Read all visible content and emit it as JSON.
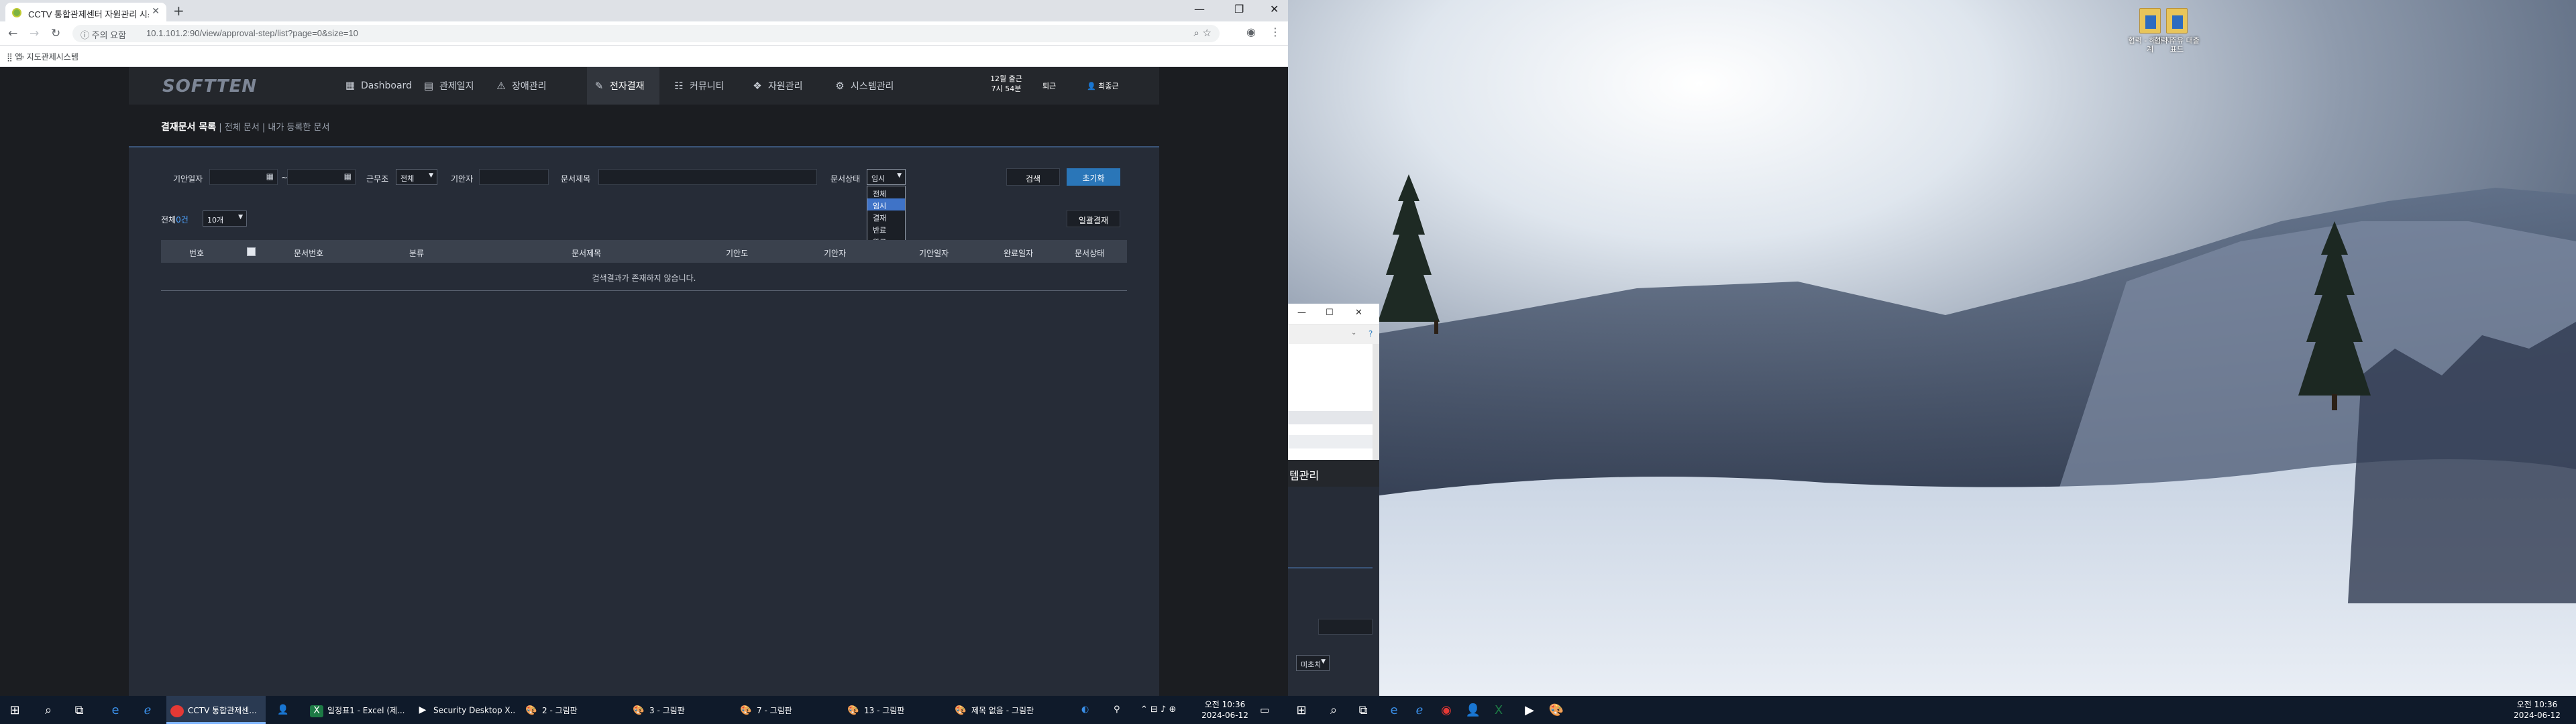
{
  "browser": {
    "tab_title": "CCTV 통합관제센터 자원관리 시스템",
    "new_tab": "+",
    "secure_label": "ⓘ 주의 요함",
    "url": "10.1.101.2:90/view/approval-step/list?page=0&size=10",
    "bookmarks": [
      {
        "label": "앱"
      },
      {
        "label": "지도관제시스템"
      }
    ]
  },
  "site": {
    "logo": "SOFTTEN",
    "menu": [
      {
        "label": "Dashboard",
        "icon": "dashboard-icon",
        "glyph": "▦"
      },
      {
        "label": "관제일지",
        "icon": "log-icon",
        "glyph": "▤"
      },
      {
        "label": "장애관리",
        "icon": "warning-icon",
        "glyph": "⚠"
      },
      {
        "label": "전자결재",
        "icon": "approval-icon",
        "glyph": "✎",
        "active": true
      },
      {
        "label": "커뮤니티",
        "icon": "community-icon",
        "glyph": "☷"
      },
      {
        "label": "자원관리",
        "icon": "resource-icon",
        "glyph": "❖"
      },
      {
        "label": "시스템관리",
        "icon": "settings-icon",
        "glyph": "⚙"
      }
    ],
    "date_line1": "12월 출근",
    "date_line2": "7시 54분",
    "checkout": "퇴근",
    "user": "최종근"
  },
  "breadcrumb": {
    "main": "결재문서 목록",
    "sub": " | 전체 문서 | 내가 등록한 문서"
  },
  "search": {
    "draft_date_label": "기안일자",
    "date_sep": "~",
    "work_type_label": "근무조",
    "work_type_value": "전체",
    "drafter_label": "기안자",
    "doc_title_label": "문서제목",
    "doc_status_label": "문서상태",
    "doc_status_value": "임시",
    "search_button": "검색",
    "reset_button": "초기화",
    "status_options": [
      "전체",
      "임시",
      "결재",
      "반료",
      "완료"
    ]
  },
  "list": {
    "total_label": "전체",
    "total_count": "0건",
    "page_size": "10개",
    "bulk_approve": "일괄결재",
    "columns": [
      "번호",
      "문서번호",
      "분류",
      "문서제목",
      "기안도",
      "기안자",
      "기안일자",
      "완료일자",
      "문서상태"
    ],
    "empty_message": "검색결과가 존재하지 않습니다."
  },
  "taskbar_left": {
    "apps": [
      {
        "label": "CCTV 통합관제센...",
        "icon": "chrome-icon",
        "active": true
      },
      {
        "label": "",
        "icon": "person-icon"
      },
      {
        "label": "일정표1 - Excel (제...",
        "icon": "excel-icon"
      },
      {
        "label": "Security Desktop X...",
        "icon": "play-icon"
      },
      {
        "label": "2 - 그림판",
        "icon": "paint-icon"
      },
      {
        "label": "3 - 그림판",
        "icon": "paint-icon"
      },
      {
        "label": "7 - 그림판",
        "icon": "paint-icon"
      },
      {
        "label": "13 - 그림판",
        "icon": "paint-icon"
      },
      {
        "label": "제목 없음 - 그림판",
        "icon": "paint-icon"
      }
    ],
    "time": "오전 10:36",
    "date": "2024-06-12"
  },
  "desktop_icons": [
    {
      "label": "협력 - 해피 자계"
    },
    {
      "label": "협력 주유 대출표드"
    }
  ],
  "other_window": {
    "menu_text": "템관리",
    "select_value": "미초치"
  },
  "taskbar_right": {
    "time": "오전 10:36",
    "date": "2024-06-12"
  },
  "colors": {
    "page_bg": "#1b1d21",
    "panel_bg": "#262c37",
    "accent_blue": "#2f7fc2",
    "reset_button": "#2a76b8"
  }
}
